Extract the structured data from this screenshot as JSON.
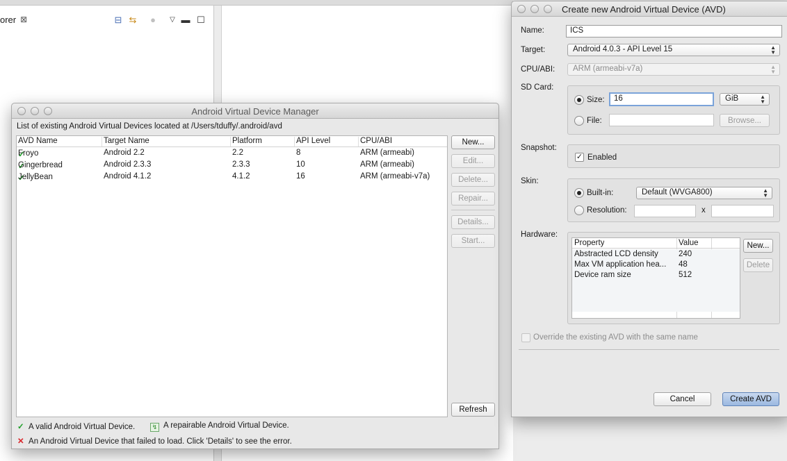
{
  "eclipse": {
    "explorer_tab": "orer",
    "explorer_close": "⊠"
  },
  "avd_manager": {
    "title": "Android Virtual Device Manager",
    "caption": "List of existing Android Virtual Devices located at /Users/tduffy/.android/avd",
    "columns": [
      "AVD Name",
      "Target Name",
      "Platform",
      "API Level",
      "CPU/ABI"
    ],
    "rows": [
      {
        "status": "valid",
        "name": "Froyo",
        "target": "Android 2.2",
        "platform": "2.2",
        "api": "8",
        "abi": "ARM (armeabi)"
      },
      {
        "status": "valid",
        "name": "Gingerbread",
        "target": "Android 2.3.3",
        "platform": "2.3.3",
        "api": "10",
        "abi": "ARM (armeabi)"
      },
      {
        "status": "valid",
        "name": "JellyBean",
        "target": "Android 4.1.2",
        "platform": "4.1.2",
        "api": "16",
        "abi": "ARM (armeabi-v7a)"
      }
    ],
    "buttons": {
      "new": "New...",
      "edit": "Edit...",
      "delete": "Delete...",
      "repair": "Repair...",
      "details": "Details...",
      "start": "Start...",
      "refresh": "Refresh"
    },
    "legend": {
      "valid": "A valid Android Virtual Device.",
      "repairable": "A repairable Android Virtual Device.",
      "failed": "An Android Virtual Device that failed to load. Click 'Details' to see the error."
    }
  },
  "create_dialog": {
    "title": "Create new Android Virtual Device (AVD)",
    "name_label": "Name:",
    "name_value": "ICS",
    "target_label": "Target:",
    "target_value": "Android 4.0.3 - API Level 15",
    "cpu_label": "CPU/ABI:",
    "cpu_value": "ARM (armeabi-v7a)",
    "sdcard": {
      "label": "SD Card:",
      "size_label": "Size:",
      "size_value": "16",
      "unit_value": "GiB",
      "file_label": "File:",
      "file_value": "",
      "browse_label": "Browse..."
    },
    "snapshot": {
      "label": "Snapshot:",
      "enabled_label": "Enabled",
      "enabled": true
    },
    "skin": {
      "label": "Skin:",
      "builtin_label": "Built-in:",
      "builtin_value": "Default (WVGA800)",
      "resolution_label": "Resolution:",
      "x_label": "x",
      "res_w": "",
      "res_h": ""
    },
    "hardware": {
      "label": "Hardware:",
      "columns": [
        "Property",
        "Value"
      ],
      "rows": [
        {
          "property": "Abstracted LCD density",
          "value": "240"
        },
        {
          "property": "Max VM application hea...",
          "value": "48"
        },
        {
          "property": "Device ram size",
          "value": "512"
        }
      ],
      "new_label": "New...",
      "delete_label": "Delete"
    },
    "override_label": "Override the existing AVD with the same name",
    "cancel_label": "Cancel",
    "create_label": "Create AVD"
  }
}
